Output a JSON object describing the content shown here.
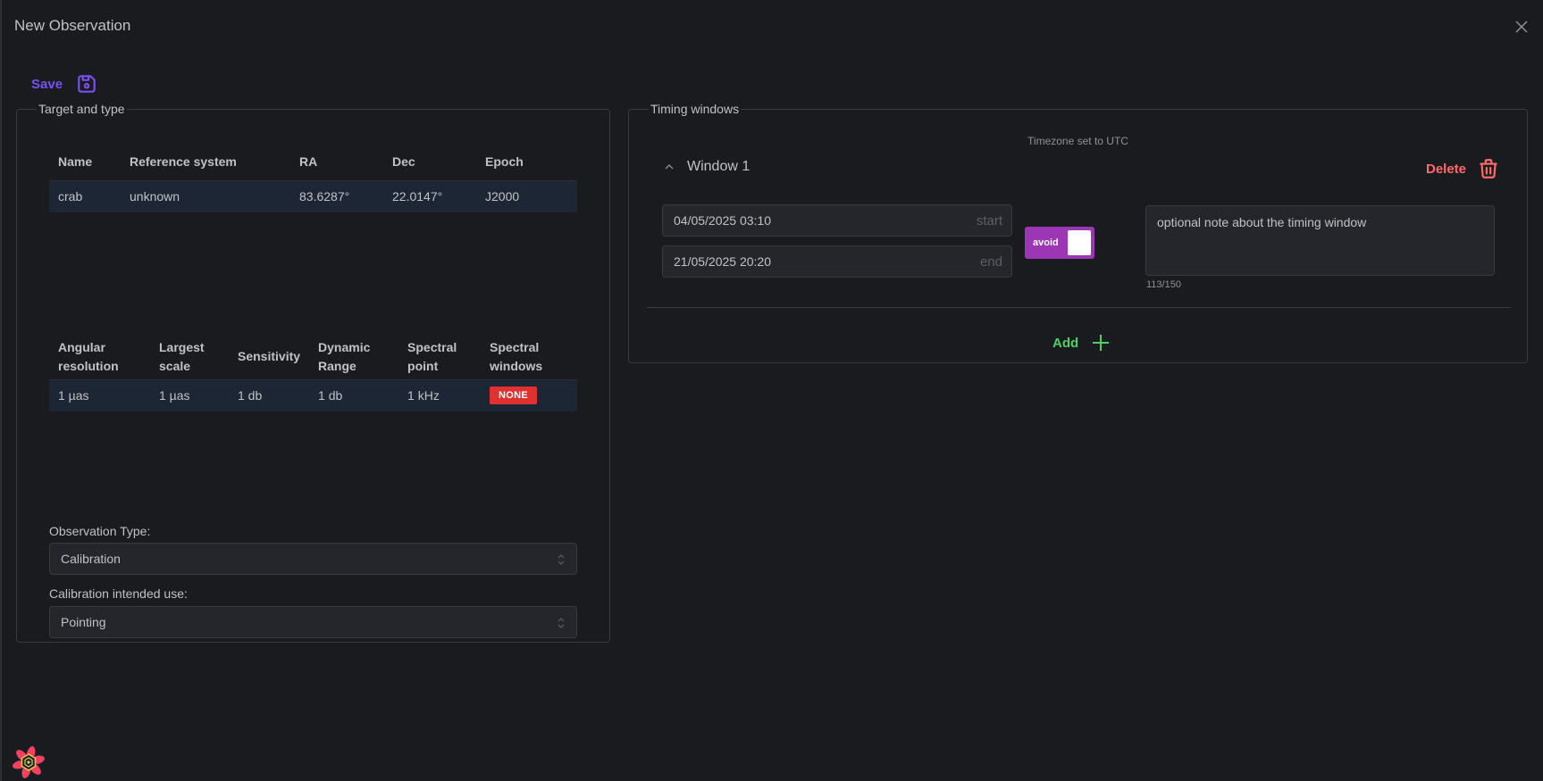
{
  "modal": {
    "title": "New Observation",
    "close_icon": "close-icon"
  },
  "toolbar": {
    "save_label": "Save",
    "save_icon": "floppy-disk-icon"
  },
  "target_panel": {
    "legend": "Target and type",
    "target_table": {
      "columns": [
        "Name",
        "Reference system",
        "RA",
        "Dec",
        "Epoch"
      ],
      "rows": [
        [
          "crab",
          "unknown",
          "83.6287°",
          "22.0147°",
          "J2000"
        ]
      ]
    },
    "performance_table": {
      "columns": [
        [
          "Angular",
          "resolution"
        ],
        [
          "Largest",
          "scale"
        ],
        [
          "Sensitivity"
        ],
        [
          "Dynamic",
          "Range"
        ],
        [
          "Spectral",
          "point"
        ],
        [
          "Spectral",
          "windows"
        ]
      ],
      "rows": [
        [
          "1 µas",
          "1 µas",
          "1 db",
          "1 db",
          "1 kHz",
          "NONE"
        ]
      ],
      "badge_color": "#e03131"
    },
    "observation_type": {
      "label": "Observation Type:",
      "value": "Calibration"
    },
    "calibration_use": {
      "label": "Calibration intended use:",
      "value": "Pointing"
    }
  },
  "timing_panel": {
    "legend": "Timing windows",
    "timezone_note": "Timezone set to UTC",
    "windows": [
      {
        "title": "Window 1",
        "expanded": true,
        "start": "04/05/2025 03:10",
        "start_suffix": "start",
        "end": "21/05/2025 20:20",
        "end_suffix": "end",
        "avoid_label": "avoid",
        "avoid_on": true,
        "note": "optional note about the timing window",
        "char_count": "113/150",
        "delete_label": "Delete"
      }
    ],
    "add_label": "Add"
  },
  "colors": {
    "save_accent": "#7950f2",
    "delete_accent": "#ff6b6b",
    "add_accent": "#51cf66",
    "avoid_switch": "#9c36b5",
    "row_highlight": "#1d2634",
    "background": "#1a1b1e"
  }
}
